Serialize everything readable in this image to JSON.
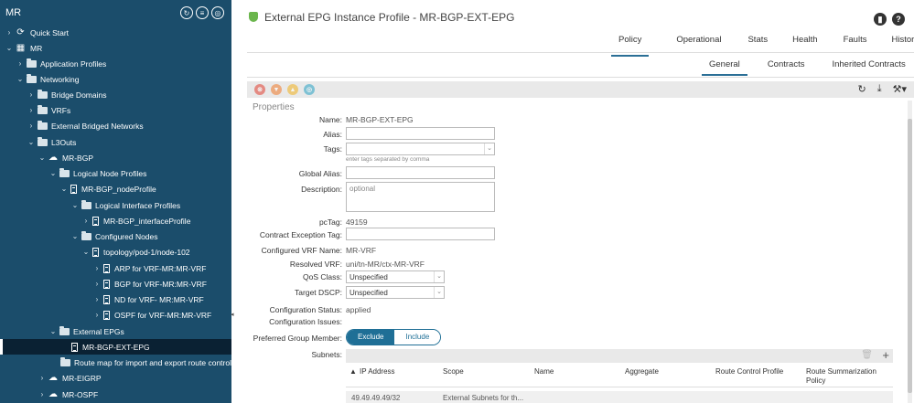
{
  "sidebar": {
    "title": "MR",
    "items": [
      {
        "label": "Quick Start"
      },
      {
        "label": "MR"
      },
      {
        "label": "Application Profiles"
      },
      {
        "label": "Networking"
      },
      {
        "label": "Bridge Domains"
      },
      {
        "label": "VRFs"
      },
      {
        "label": "External Bridged Networks"
      },
      {
        "label": "L3Outs"
      },
      {
        "label": "MR-BGP"
      },
      {
        "label": "Logical Node Profiles"
      },
      {
        "label": "MR-BGP_nodeProfile"
      },
      {
        "label": "Logical Interface Profiles"
      },
      {
        "label": "MR-BGP_interfaceProfile"
      },
      {
        "label": "Configured Nodes"
      },
      {
        "label": "topology/pod-1/node-102"
      },
      {
        "label": "ARP for VRF-MR:MR-VRF"
      },
      {
        "label": "BGP for VRF-MR:MR-VRF"
      },
      {
        "label": "ND for VRF- MR:MR-VRF"
      },
      {
        "label": "OSPF for VRF-MR:MR-VRF"
      },
      {
        "label": "External EPGs"
      },
      {
        "label": "MR-BGP-EXT-EPG"
      },
      {
        "label": "Route map for import and export route control"
      },
      {
        "label": "MR-EIGRP"
      },
      {
        "label": "MR-OSPF"
      }
    ]
  },
  "header": {
    "title": "External EPG Instance Profile - MR-BGP-EXT-EPG"
  },
  "tabs_primary": [
    "Policy",
    "Operational",
    "Stats",
    "Health",
    "Faults",
    "History"
  ],
  "tabs_secondary": [
    "General",
    "Contracts",
    "Inherited Contracts"
  ],
  "properties": {
    "section_title": "Properties",
    "name_label": "Name:",
    "name_value": "MR-BGP-EXT-EPG",
    "alias_label": "Alias:",
    "tags_label": "Tags:",
    "tags_hint": "enter tags separated by comma",
    "global_alias_label": "Global Alias:",
    "description_label": "Description:",
    "description_placeholder": "optional",
    "pctag_label": "pcTag:",
    "pctag_value": "49159",
    "contract_exception_label": "Contract Exception Tag:",
    "configured_vrf_label": "Configured VRF Name:",
    "configured_vrf_value": "MR-VRF",
    "resolved_vrf_label": "Resolved VRF:",
    "resolved_vrf_value": "uni/tn-MR/ctx-MR-VRF",
    "qos_label": "QoS Class:",
    "qos_value": "Unspecified",
    "dscp_label": "Target DSCP:",
    "dscp_value": "Unspecified",
    "config_status_label": "Configuration Status:",
    "config_status_value": "applied",
    "config_issues_label": "Configuration Issues:",
    "pref_group_label": "Preferred Group Member:",
    "pref_group_on": "Exclude",
    "pref_group_off": "Include",
    "subnets_label": "Subnets:"
  },
  "subnets": {
    "columns": [
      "IP Address",
      "Scope",
      "Name",
      "Aggregate",
      "Route Control Profile",
      "Route Summarization Policy"
    ],
    "rows": [
      {
        "ip": "49.49.49.49/32",
        "scope": "External Subnets for th..."
      }
    ]
  },
  "colors": {
    "sidebar_bg": "#1b4d6b",
    "accent": "#1f6f96",
    "selected_bg": "#0a2133"
  }
}
